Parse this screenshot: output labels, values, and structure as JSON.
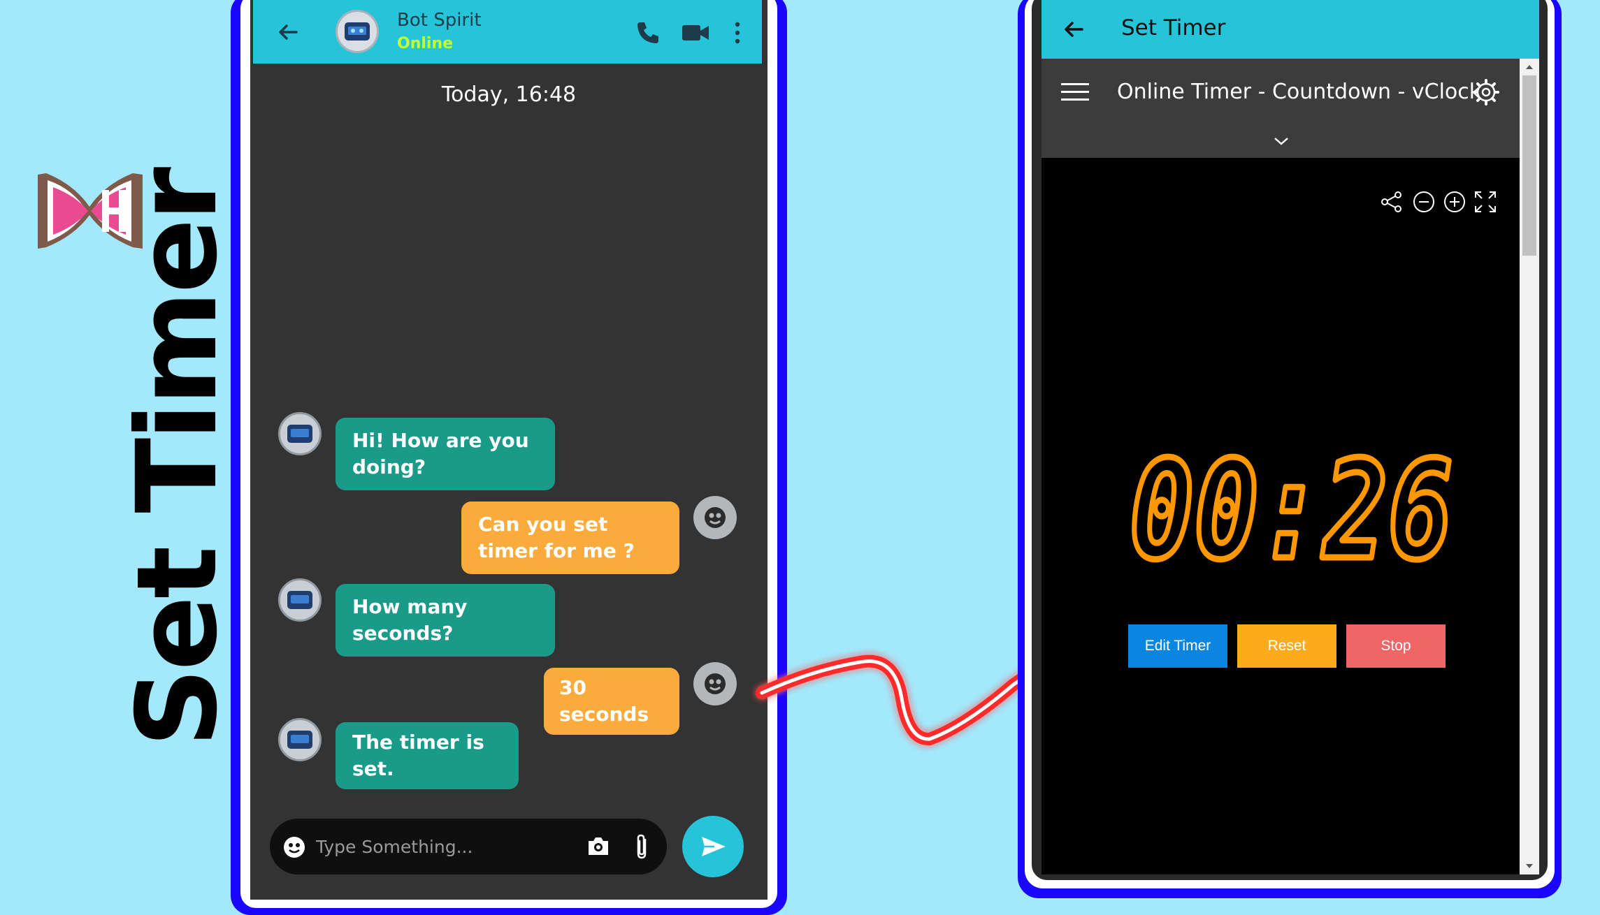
{
  "branding": {
    "title": "Set Timer",
    "logo_icon": "hourglass-bow-icon"
  },
  "chat": {
    "header": {
      "name": "Bot Spirit",
      "status": "Online",
      "back_icon": "arrow-left-icon",
      "call_icon": "phone-icon",
      "video_icon": "video-camera-icon",
      "menu_icon": "kebab-menu-icon"
    },
    "date_label": "Today, 16:48",
    "messages": [
      {
        "from": "bot",
        "text": "Hi! How are you doing?"
      },
      {
        "from": "user",
        "text": "Can you set timer for me ?"
      },
      {
        "from": "bot",
        "text": "How many seconds?"
      },
      {
        "from": "user",
        "text": "30 seconds"
      },
      {
        "from": "bot",
        "text": "The timer is set."
      }
    ],
    "input": {
      "placeholder": "Type Something...",
      "emoji_icon": "smiley-icon",
      "camera_icon": "camera-icon",
      "attach_icon": "paperclip-icon",
      "send_icon": "send-icon"
    },
    "colors": {
      "header": "#25c4d9",
      "bot_bubble": "#1a9a88",
      "user_bubble": "#fbab3c",
      "status": "#c6ff2e"
    }
  },
  "timer_app": {
    "header_title": "Set Timer",
    "web_title": "Online Timer - Countdown - vClock",
    "toolbar_icons": [
      "share-icon",
      "zoom-out-icon",
      "zoom-in-icon",
      "fullscreen-icon"
    ],
    "display": "00:26",
    "buttons": [
      {
        "label": "Edit Timer",
        "color": "#0a86e0"
      },
      {
        "label": "Reset",
        "color": "#fbab1c"
      },
      {
        "label": "Stop",
        "color": "#f06566"
      }
    ],
    "digit_color": "#ff9800"
  }
}
